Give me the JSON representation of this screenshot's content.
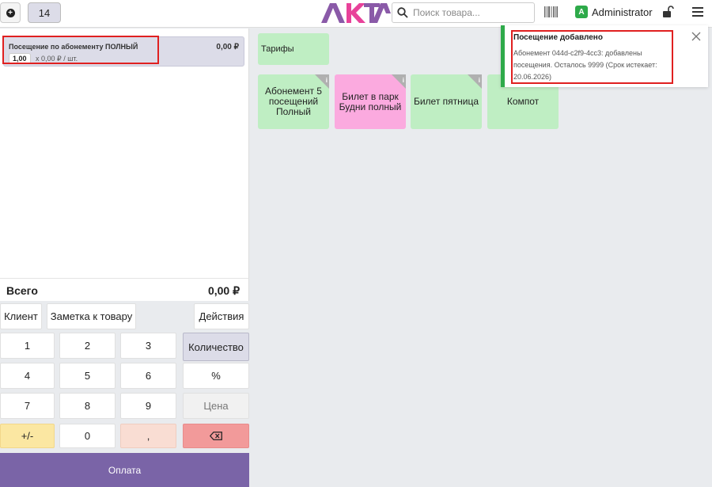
{
  "header": {
    "tab_number": "14",
    "search_placeholder": "Поиск товара...",
    "user_initial": "A",
    "user_name": "Administrator"
  },
  "order": {
    "item_name": "Посещение по абонементу ПОЛНЫЙ",
    "item_price": "0,00 ₽",
    "item_qty": "1,00",
    "item_unit_price": "x 0,00 ₽ / шт."
  },
  "total": {
    "label": "Всего",
    "value": "0,00 ₽"
  },
  "actions": {
    "client": "Клиент",
    "note": "Заметка к товару",
    "actions": "Действия"
  },
  "keypad": {
    "k1": "1",
    "k2": "2",
    "k3": "3",
    "k4": "4",
    "k5": "5",
    "k6": "6",
    "k7": "7",
    "k8": "8",
    "k9": "9",
    "plusminus": "+/-",
    "k0": "0",
    "comma": ",",
    "quantity": "Количество",
    "percent": "%",
    "price": "Цена"
  },
  "pay_label": "Оплата",
  "products": {
    "category": "Тарифы",
    "items": [
      "Абонемент 5 посещений Полный",
      "Билет в парк Будни полный",
      "Билет пятница",
      "Компот"
    ]
  },
  "toast": {
    "title": "Посещение добавлено",
    "body": "Абонемент 044d-c2f9-4cc3: добавлены посещения. Осталось 9999 (Срок истекает: 20.06.2026)"
  },
  "colors": {
    "accent": "#7a64a7",
    "success": "#2eaa4a",
    "tile_green": "#bfeec3",
    "tile_pink": "#fbaadf",
    "highlight": "#e02020"
  }
}
